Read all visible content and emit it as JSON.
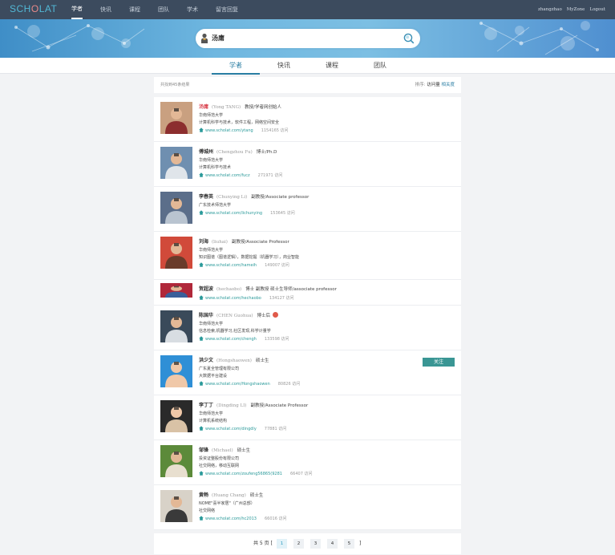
{
  "topbar": {
    "logo": {
      "a": "SCH",
      "o": "O",
      "b": "LAT"
    },
    "nav": [
      "学者",
      "快讯",
      "课程",
      "团队",
      "学术",
      "留言回复"
    ],
    "links": [
      "zhangzhao",
      "MyZone",
      "Logout"
    ]
  },
  "search": {
    "query": "汤庸"
  },
  "tabs": [
    "学者",
    "快讯",
    "课程",
    "团队"
  ],
  "results": {
    "count_text": "共找到45条结果",
    "sort_label": "排序:",
    "sort_current": "访问量",
    "sort_alt": "相关度"
  },
  "scholars": [
    {
      "name": "汤庸",
      "en": "(Yong TANG)",
      "title": "教授/学者网创始人",
      "org": "华南师范大学",
      "field": "计算机科学与技术，软件工程，网络空间安全",
      "url": "www.scholat.com/ytang",
      "visits": "1154165 访问"
    },
    {
      "name": "傅城州",
      "en": "(Chengzhou Fu)",
      "title": "博士/Ph.D",
      "org": "华南师范大学",
      "field": "计算机科学与技术",
      "url": "www.scholat.com/fucz",
      "visits": "271971 访问"
    },
    {
      "name": "李春英",
      "en": "(Chunying Li)",
      "title": "副教授/Associate professor",
      "org": "广东技术师范大学",
      "field": "",
      "url": "www.scholat.com/lichunying",
      "visits": "153645 访问"
    },
    {
      "name": "刘海",
      "en": "(liuhai)",
      "title": "副教授/Associate Professor",
      "org": "华南师范大学",
      "field": "知识图谱（图谱逻辑），数据挖掘（机器学习），商业智能",
      "url": "www.scholat.com/hameih",
      "visits": "149007 访问"
    },
    {
      "name": "贺超波",
      "en": "(hechaobo)",
      "title": "博士 副教授 硕士生导师/associate professor",
      "org": "",
      "field": "",
      "url": "www.scholat.com/hechaobo",
      "visits": "134127 访问"
    },
    {
      "name": "陈国华",
      "en": "(CHEN Guohua)",
      "title": "博士后",
      "org": "华南师范大学",
      "field": "信息检索,机器学习,社区发现,科学计量学",
      "url": "www.scholat.com/chengh",
      "visits": "133598 访问"
    },
    {
      "name": "洪少文",
      "en": "(Hongshaowen)",
      "title": "硕士生",
      "org": "广东夏全管理有限公司",
      "field": "大数据平台建设",
      "url": "www.scholat.com/Hongshaowen",
      "visits": "80826 访问",
      "follow": "关注"
    },
    {
      "name": "李丁丁",
      "en": "(Dingding LI)",
      "title": "副教授/Associate Professor",
      "org": "华南师范大学",
      "field": "计算机系统结构",
      "url": "www.scholat.com/dingdly",
      "visits": "77881 访问"
    },
    {
      "name": "邹锋",
      "en": "(Michael)",
      "title": "硕士生",
      "org": "投资证整股份有限公司",
      "field": "社交网络，移动互联网",
      "url": "www.scholat.com/zoufeng56865(9281",
      "visits": "66407 访问"
    },
    {
      "name": "黄畅",
      "en": "(Huang Chang)",
      "title": "硕士生",
      "org": "NOME\"喜半家居\"（广州总部）",
      "field": "社交网络",
      "url": "www.scholat.com/hc2013",
      "visits": "66016 访问"
    }
  ],
  "pager": {
    "prefix": "共 5 页 [",
    "pages": [
      "1",
      "2",
      "3",
      "4",
      "5"
    ],
    "suffix": "]"
  },
  "colors": {
    "accent": "#2a7ea3",
    "highlight": "#d9434f",
    "topbar": "#3c4b5e",
    "follow": "#3a9694"
  }
}
